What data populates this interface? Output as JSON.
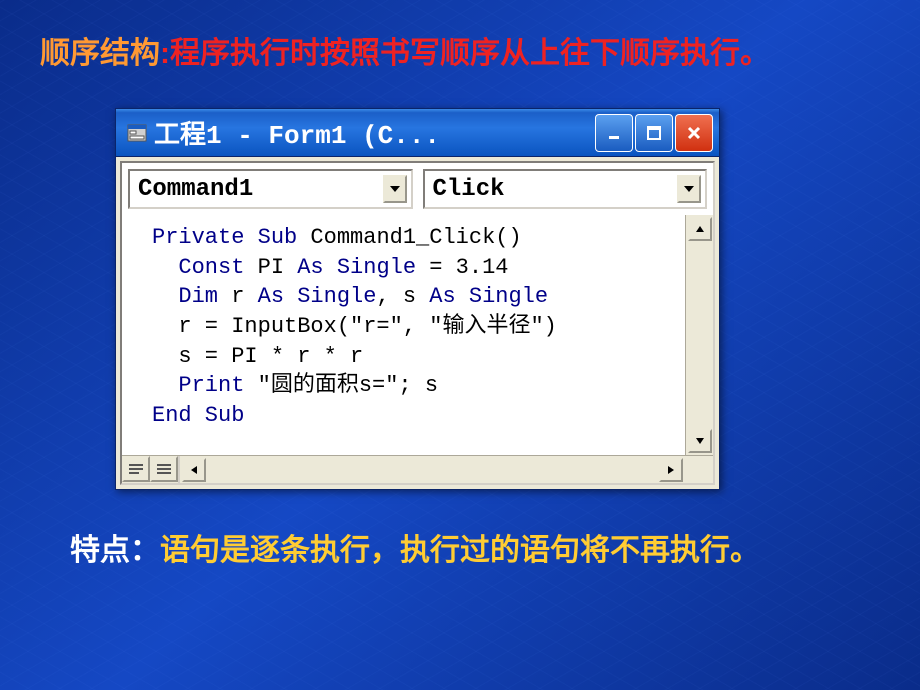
{
  "heading": {
    "term": "顺序结构",
    "colon": ":",
    "definition": "程序执行时按照书写顺序从上往下顺序执行。"
  },
  "window": {
    "title": "工程1 - Form1 (C...",
    "dropdown1": "Command1",
    "dropdown2": "Click"
  },
  "code": {
    "line1_a": "Private Sub",
    "line1_b": " Command1_Click()",
    "line2_a": "  Const",
    "line2_b": " PI ",
    "line2_c": "As Single",
    "line2_d": " = 3.14",
    "line3_a": "  Dim",
    "line3_b": " r ",
    "line3_c": "As Single",
    "line3_d": ", s ",
    "line3_e": "As Single",
    "line4": "  r = InputBox(\"r=\", \"输入半径\")",
    "line5": "  s = PI * r * r",
    "line6_a": "  Print",
    "line6_b": " \"圆的面积s=\"; s",
    "line7": "End Sub"
  },
  "footer": {
    "label": "特点：",
    "text": "语句是逐条执行，执行过的语句将不再执行。"
  }
}
